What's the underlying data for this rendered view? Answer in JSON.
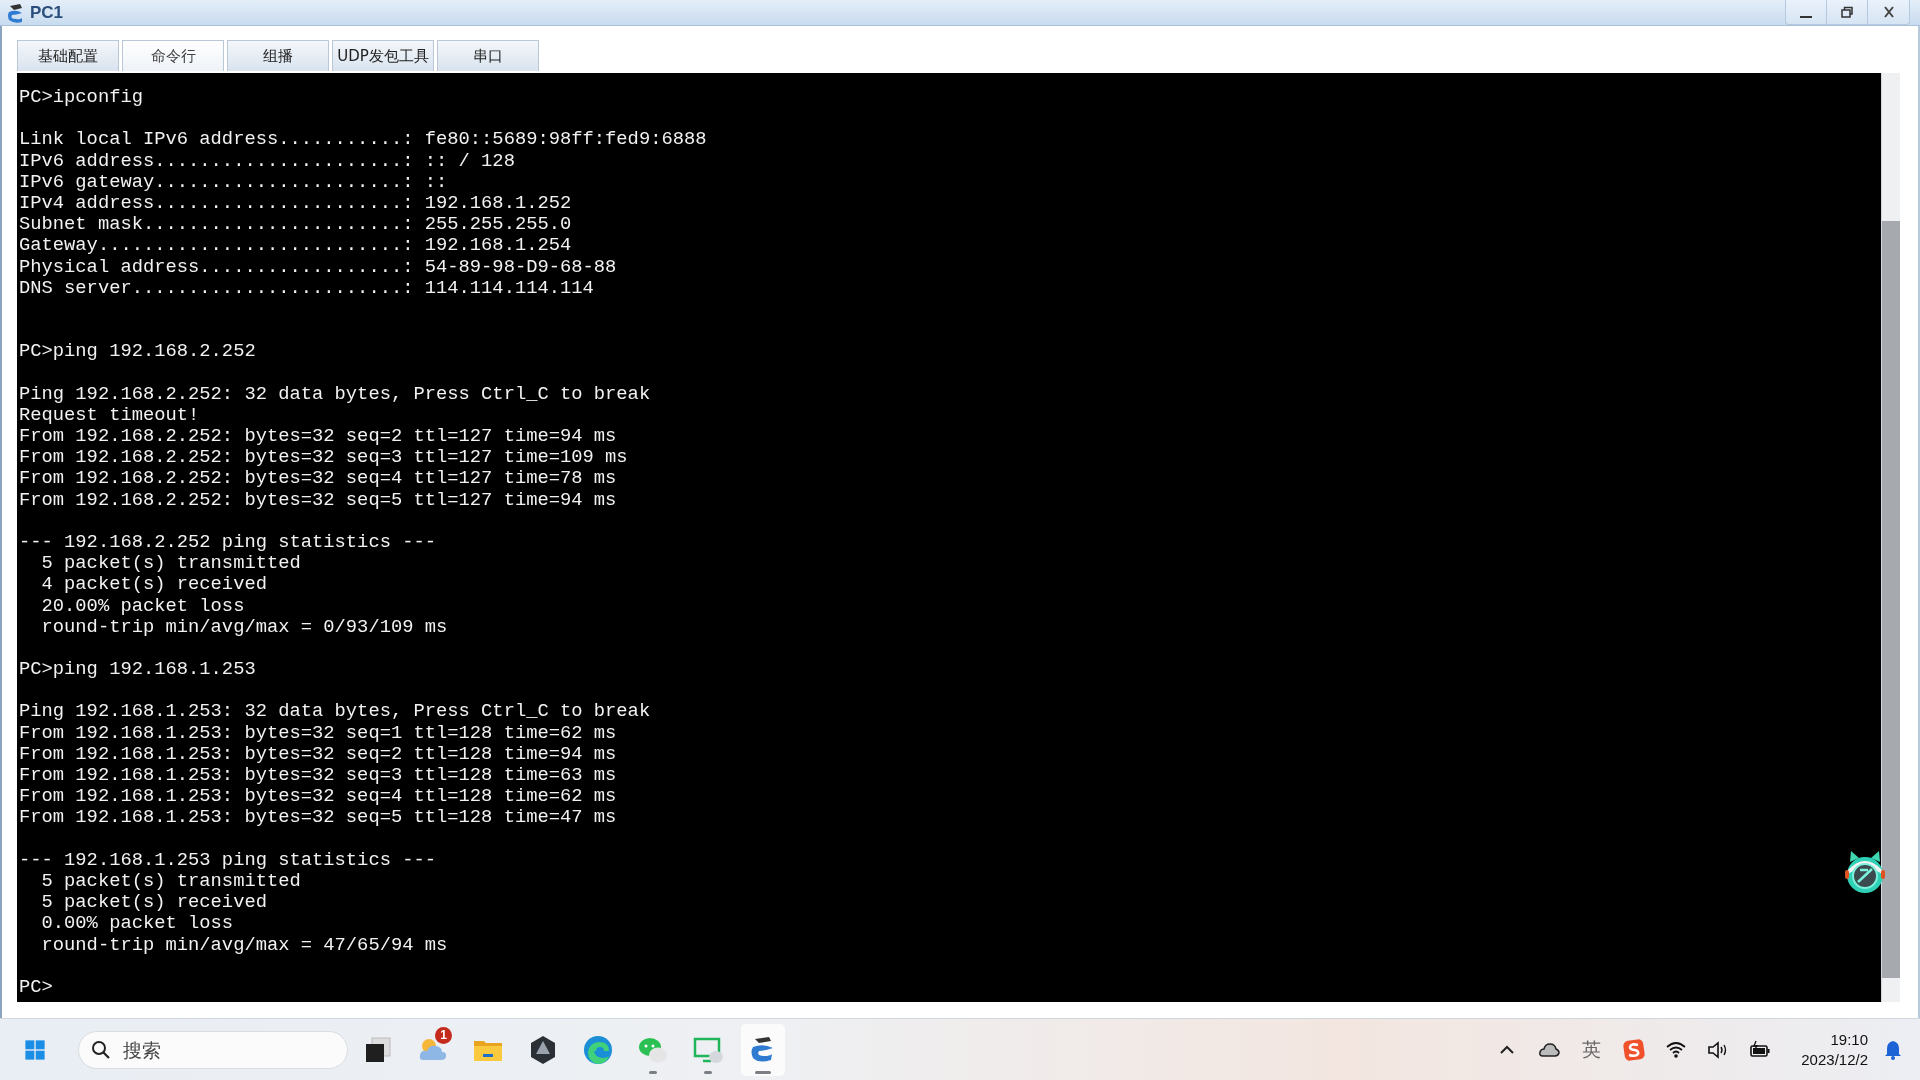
{
  "window": {
    "title": "PC1"
  },
  "tabs": [
    {
      "label": "基础配置",
      "selected": false
    },
    {
      "label": "命令行",
      "selected": true
    },
    {
      "label": "组播",
      "selected": false
    },
    {
      "label": "UDP发包工具",
      "selected": false
    },
    {
      "label": "串口",
      "selected": false
    }
  ],
  "terminal": {
    "blocks": [
      {
        "spaced": false,
        "lines": [
          "PC>ipconfig"
        ]
      },
      {
        "spaced": false,
        "lines": [
          "Link local IPv6 address...........: fe80::5689:98ff:fed9:6888",
          "IPv6 address......................: :: / 128",
          "IPv6 gateway......................: ::",
          "IPv4 address......................: 192.168.1.252",
          "Subnet mask.......................: 255.255.255.0",
          "Gateway...........................: 192.168.1.254",
          "Physical address..................: 54-89-98-D9-68-88",
          "DNS server........................: 114.114.114.114"
        ]
      },
      {
        "spaced": true,
        "lines": [
          "PC>ping 192.168.2.252"
        ]
      },
      {
        "spaced": false,
        "lines": [
          "Ping 192.168.2.252: 32 data bytes, Press Ctrl_C to break",
          "Request timeout!",
          "From 192.168.2.252: bytes=32 seq=2 ttl=127 time=94 ms",
          "From 192.168.2.252: bytes=32 seq=3 ttl=127 time=109 ms",
          "From 192.168.2.252: bytes=32 seq=4 ttl=127 time=78 ms",
          "From 192.168.2.252: bytes=32 seq=5 ttl=127 time=94 ms"
        ]
      },
      {
        "spaced": false,
        "lines": [
          "--- 192.168.2.252 ping statistics ---",
          "  5 packet(s) transmitted",
          "  4 packet(s) received",
          "  20.00% packet loss",
          "  round-trip min/avg/max = 0/93/109 ms"
        ]
      },
      {
        "spaced": false,
        "lines": [
          "PC>ping 192.168.1.253"
        ]
      },
      {
        "spaced": false,
        "lines": [
          "Ping 192.168.1.253: 32 data bytes, Press Ctrl_C to break",
          "From 192.168.1.253: bytes=32 seq=1 ttl=128 time=62 ms",
          "From 192.168.1.253: bytes=32 seq=2 ttl=128 time=94 ms",
          "From 192.168.1.253: bytes=32 seq=3 ttl=128 time=63 ms",
          "From 192.168.1.253: bytes=32 seq=4 ttl=128 time=62 ms",
          "From 192.168.1.253: bytes=32 seq=5 ttl=128 time=47 ms"
        ]
      },
      {
        "spaced": false,
        "lines": [
          "--- 192.168.1.253 ping statistics ---",
          "  5 packet(s) transmitted",
          "  5 packet(s) received",
          "  0.00% packet loss",
          "  round-trip min/avg/max = 47/65/94 ms"
        ]
      },
      {
        "spaced": false,
        "lines": [
          "PC>"
        ]
      }
    ]
  },
  "taskbar": {
    "search": {
      "placeholder": "搜索"
    },
    "apps": [
      {
        "kind": "task-view",
        "running": false,
        "selected": false
      },
      {
        "kind": "weather",
        "running": false,
        "selected": false,
        "badge": "1"
      },
      {
        "kind": "folder",
        "running": false,
        "selected": false
      },
      {
        "kind": "hexagon",
        "running": false,
        "selected": false
      },
      {
        "kind": "browser",
        "running": false,
        "selected": false
      },
      {
        "kind": "chat",
        "running": true,
        "selected": false
      },
      {
        "kind": "monitor-chat",
        "running": true,
        "selected": false
      },
      {
        "kind": "network",
        "running": true,
        "selected": true
      }
    ],
    "tray": {
      "input_language": "英"
    },
    "clock": {
      "time": "19:10",
      "date": "2023/12/2"
    }
  }
}
